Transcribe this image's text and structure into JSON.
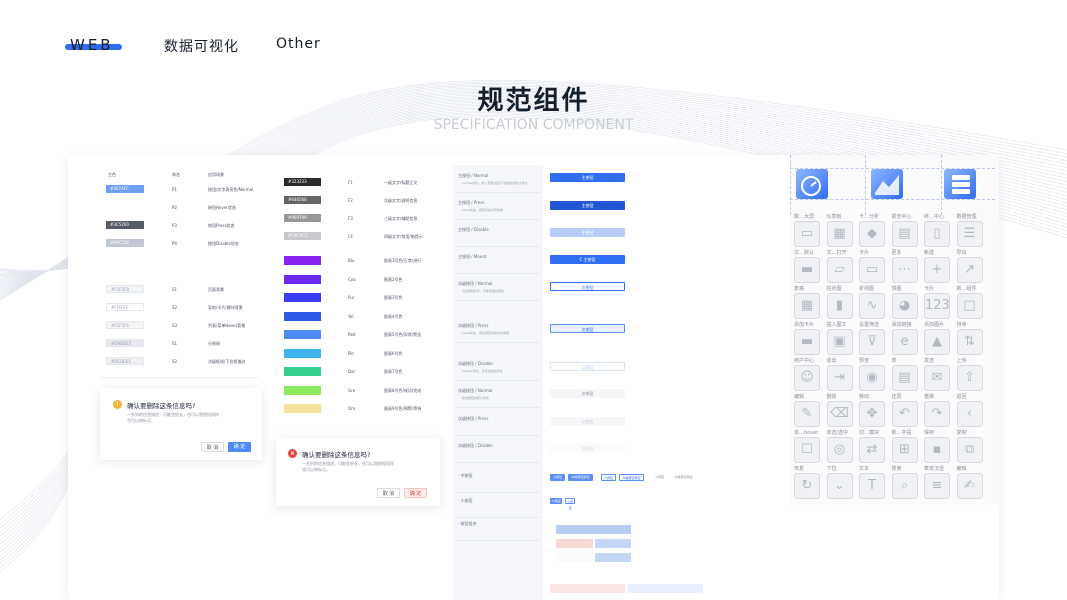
{
  "nav": {
    "brand": "WEB",
    "viz": "数据可视化",
    "other": "Other"
  },
  "hero": {
    "title": "规范组件",
    "subtitle": "SPECIFICATION COMPONENT"
  },
  "colors": {
    "brand": "#2f6df2",
    "accent_blue": "#2f6df2",
    "danger": "#e2463d",
    "warning": "#f5b335"
  },
  "text_table": {
    "headers": [
      "主色",
      "命名",
      "应用场景"
    ],
    "rows": [
      {
        "swatch": "#2E7AFC",
        "color": "#6f9ef6",
        "name": "P1",
        "use": "按钮/文字高亮色/Normal"
      },
      {
        "swatch": "",
        "color": "",
        "name": "P2",
        "use": "按钮Hover状态"
      },
      {
        "swatch": "#3C5260",
        "color": "#555a66",
        "name": "P3",
        "use": "按钮Press状态"
      },
      {
        "swatch": "#B9C5DE",
        "color": "#c0c6d2",
        "name": "P4",
        "use": "按钮Disable状态"
      },
      {
        "swatch": "#F2F5F8",
        "color": "#f2f5f8",
        "name": "S1",
        "use": "页面背景"
      },
      {
        "swatch": "#FFFFFF",
        "color": "#ffffff",
        "name": "S2",
        "use": "导航/卡片/模块背景"
      },
      {
        "swatch": "#F5F5F6",
        "color": "#f5f5f6",
        "name": "S3",
        "use": "列表/菜单Hover背景"
      },
      {
        "swatch": "#D9DDE5",
        "color": "#e8eaef",
        "name": "S1",
        "use": "分割线"
      },
      {
        "swatch": "#DCDEE5",
        "color": "#eef0f3",
        "name": "S2",
        "use": "次级框线/下拉框描边"
      }
    ]
  },
  "text_colors": [
    {
      "swatch": "#323233",
      "color": "#2b2b2c",
      "name": "F1",
      "use": "一级文字/标题正文"
    },
    {
      "swatch": "#646566",
      "color": "#646566",
      "name": "F2",
      "use": "次级文字/说明信息"
    },
    {
      "swatch": "#969799",
      "color": "#969799",
      "name": "F3",
      "use": "三级文字/辅助信息"
    },
    {
      "swatch": "#C8C9CC",
      "color": "#c8c9cc",
      "name": "F4",
      "use": "四级文字/禁用/暗提示"
    }
  ],
  "chart_colors": [
    {
      "color": "#8a22ee",
      "name": "Blu",
      "use": "图表1号色/正常/进行"
    },
    {
      "color": "#6c28ee",
      "name": "Cya",
      "use": "图表2号色"
    },
    {
      "color": "#3a3cf0",
      "name": "Pur",
      "use": "图表3号色"
    },
    {
      "color": "#2f59e8",
      "name": "Yel",
      "use": "图表4号色"
    },
    {
      "color": "#4c8cf2",
      "name": "Red",
      "use": "图表5号色/异常/警告"
    },
    {
      "color": "#3fb5f0",
      "name": "Pin",
      "use": "图表6号色"
    },
    {
      "color": "#35cf8f",
      "name": "Dar",
      "use": "图表7号色"
    },
    {
      "color": "#8bea60",
      "name": "Gre",
      "use": "图表8号色/成功/完成"
    },
    {
      "color": "#f5e29a",
      "name": "Ora",
      "use": "图表9号色/预警/等待"
    }
  ],
  "dialog_warn": {
    "title": "确认要删除这条信息吗?",
    "body1": "一系列的信息描述，可能会很长，也可以是很短同样",
    "body2": "也可以带标点。",
    "cancel": "取 消",
    "ok": "确 定"
  },
  "dialog_danger": {
    "title": "确认要删除这条信息吗?",
    "body1": "一系列的信息描述，可能会很长，也可以是很短同样",
    "body2": "也可以带标点。",
    "cancel": "取 消",
    "ok": "确 定"
  },
  "button_states": [
    {
      "label": "主按钮 / Normal",
      "desc": "· normal状态，载入页面/设置下拉框后的默认状态"
    },
    {
      "label": "主按钮 / Press",
      "desc": "· press状态，按压时的背景效果"
    },
    {
      "label": "主按钮 / Disable",
      "desc": ""
    },
    {
      "label": "主按钮 / Mount",
      "desc": ""
    },
    {
      "label": "次级按钮 / Normal",
      "desc": "· 与主按钮共存，可使用描边按钮"
    },
    {
      "label": "次级按钮 / Press",
      "desc": "· press状态，鼠标按压时的状态效果"
    },
    {
      "label": "次级按钮 / Disable",
      "desc": "· disable状态，可点击后的状态"
    },
    {
      "label": "次级按钮 / Normal",
      "desc": "· 常态按钮的默认状态"
    },
    {
      "label": "次级按钮 / Press",
      "desc": ""
    },
    {
      "label": "次级按钮 / Disable",
      "desc": ""
    },
    {
      "label": "· 中按钮",
      "desc": ""
    },
    {
      "label": "· 小按钮",
      "desc": ""
    },
    {
      "label": "· 按钮组合",
      "desc": ""
    }
  ],
  "button_text": {
    "primary": "主按钮",
    "secondary": "次按钮",
    "loading": "C 主按钮",
    "small1": "小按钮",
    "small2": "中等按钮按钮"
  },
  "icons": [
    {
      "label": "数…大屏",
      "name": "screen-icon"
    },
    {
      "label": "仪表板",
      "name": "dashboard-icon"
    },
    {
      "label": "卡…分析",
      "name": "card-analysis-icon"
    },
    {
      "label": "报告中心",
      "name": "report-icon"
    },
    {
      "label": "终…中心",
      "name": "terminal-icon"
    },
    {
      "label": "数据管理",
      "name": "data-manage-icon"
    },
    {
      "label": "文…默认",
      "name": "folder-default-icon"
    },
    {
      "label": "文…打开",
      "name": "folder-open-icon"
    },
    {
      "label": "卡片",
      "name": "card-icon"
    },
    {
      "label": "更多",
      "name": "more-icon"
    },
    {
      "label": "新建",
      "name": "add-icon"
    },
    {
      "label": "导出",
      "name": "export-icon"
    },
    {
      "label": "表格",
      "name": "table-icon"
    },
    {
      "label": "柱状图",
      "name": "bar-chart-icon"
    },
    {
      "label": "折线图",
      "name": "line-chart-icon"
    },
    {
      "label": "饼图",
      "name": "pie-chart-icon"
    },
    {
      "label": "卡片",
      "name": "number-card-icon"
    },
    {
      "label": "新…组件",
      "name": "new-component-icon"
    },
    {
      "label": "添加卡片",
      "name": "add-card-icon"
    },
    {
      "label": "插入图文",
      "name": "insert-image-icon"
    },
    {
      "label": "设置筛选",
      "name": "filter-icon"
    },
    {
      "label": "添加链接",
      "name": "link-icon"
    },
    {
      "label": "添加图片",
      "name": "image-icon"
    },
    {
      "label": "排序",
      "name": "sort-icon"
    },
    {
      "label": "用户中心",
      "name": "user-icon"
    },
    {
      "label": "退出",
      "name": "logout-icon"
    },
    {
      "label": "预览",
      "name": "preview-icon"
    },
    {
      "label": "表",
      "name": "sheet-icon"
    },
    {
      "label": "发送",
      "name": "send-icon"
    },
    {
      "label": "上传",
      "name": "upload-icon"
    },
    {
      "label": "编辑",
      "name": "edit-icon"
    },
    {
      "label": "删除",
      "name": "delete-icon"
    },
    {
      "label": "移动",
      "name": "move-icon"
    },
    {
      "label": "还原",
      "name": "undo-icon"
    },
    {
      "label": "重做",
      "name": "redo-icon"
    },
    {
      "label": "返回",
      "name": "back-icon"
    },
    {
      "label": "单…hover",
      "name": "checkbox-hover-icon"
    },
    {
      "label": "单选/选中",
      "name": "radio-checked-icon"
    },
    {
      "label": "切…模块",
      "name": "switch-module-icon"
    },
    {
      "label": "新…字段",
      "name": "new-field-icon"
    },
    {
      "label": "保存",
      "name": "save-icon"
    },
    {
      "label": "复制",
      "name": "copy-icon"
    },
    {
      "label": "恢复",
      "name": "restore-icon"
    },
    {
      "label": "下拉",
      "name": "dropdown-icon"
    },
    {
      "label": "文本",
      "name": "text-icon"
    },
    {
      "label": "搜索",
      "name": "search-icon"
    },
    {
      "label": "菜单汉堡",
      "name": "menu-icon"
    },
    {
      "label": "编辑",
      "name": "edit2-icon"
    }
  ]
}
